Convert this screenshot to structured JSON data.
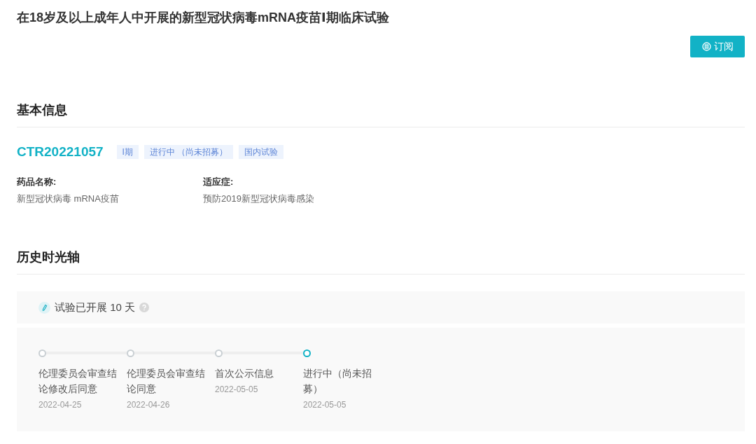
{
  "title": "在18岁及以上成年人中开展的新型冠状病毒mRNA疫苗Ⅰ期临床试验",
  "subscribe_button": "订阅",
  "basic_info": {
    "heading": "基本信息",
    "trial_id": "CTR20221057",
    "tags": [
      "I期",
      "进行中 （尚未招募）",
      "国内试验"
    ],
    "fields": [
      {
        "label": "药品名称:",
        "value": "新型冠状病毒 mRNA疫苗"
      },
      {
        "label": "适应症:",
        "value": "预防2019新型冠状病毒感染"
      }
    ]
  },
  "timeline": {
    "heading": "历史时光轴",
    "duration": "试验已开展 10 天",
    "steps": [
      {
        "label": "伦理委员会审查结论修改后同意",
        "date": "2022-04-25",
        "selected": false
      },
      {
        "label": "伦理委员会审查结论同意",
        "date": "2022-04-26",
        "selected": false
      },
      {
        "label": "首次公示信息",
        "date": "2022-05-05",
        "selected": false
      },
      {
        "label": "进行中（尚未招募）",
        "date": "2022-05-05",
        "selected": true
      }
    ]
  }
}
